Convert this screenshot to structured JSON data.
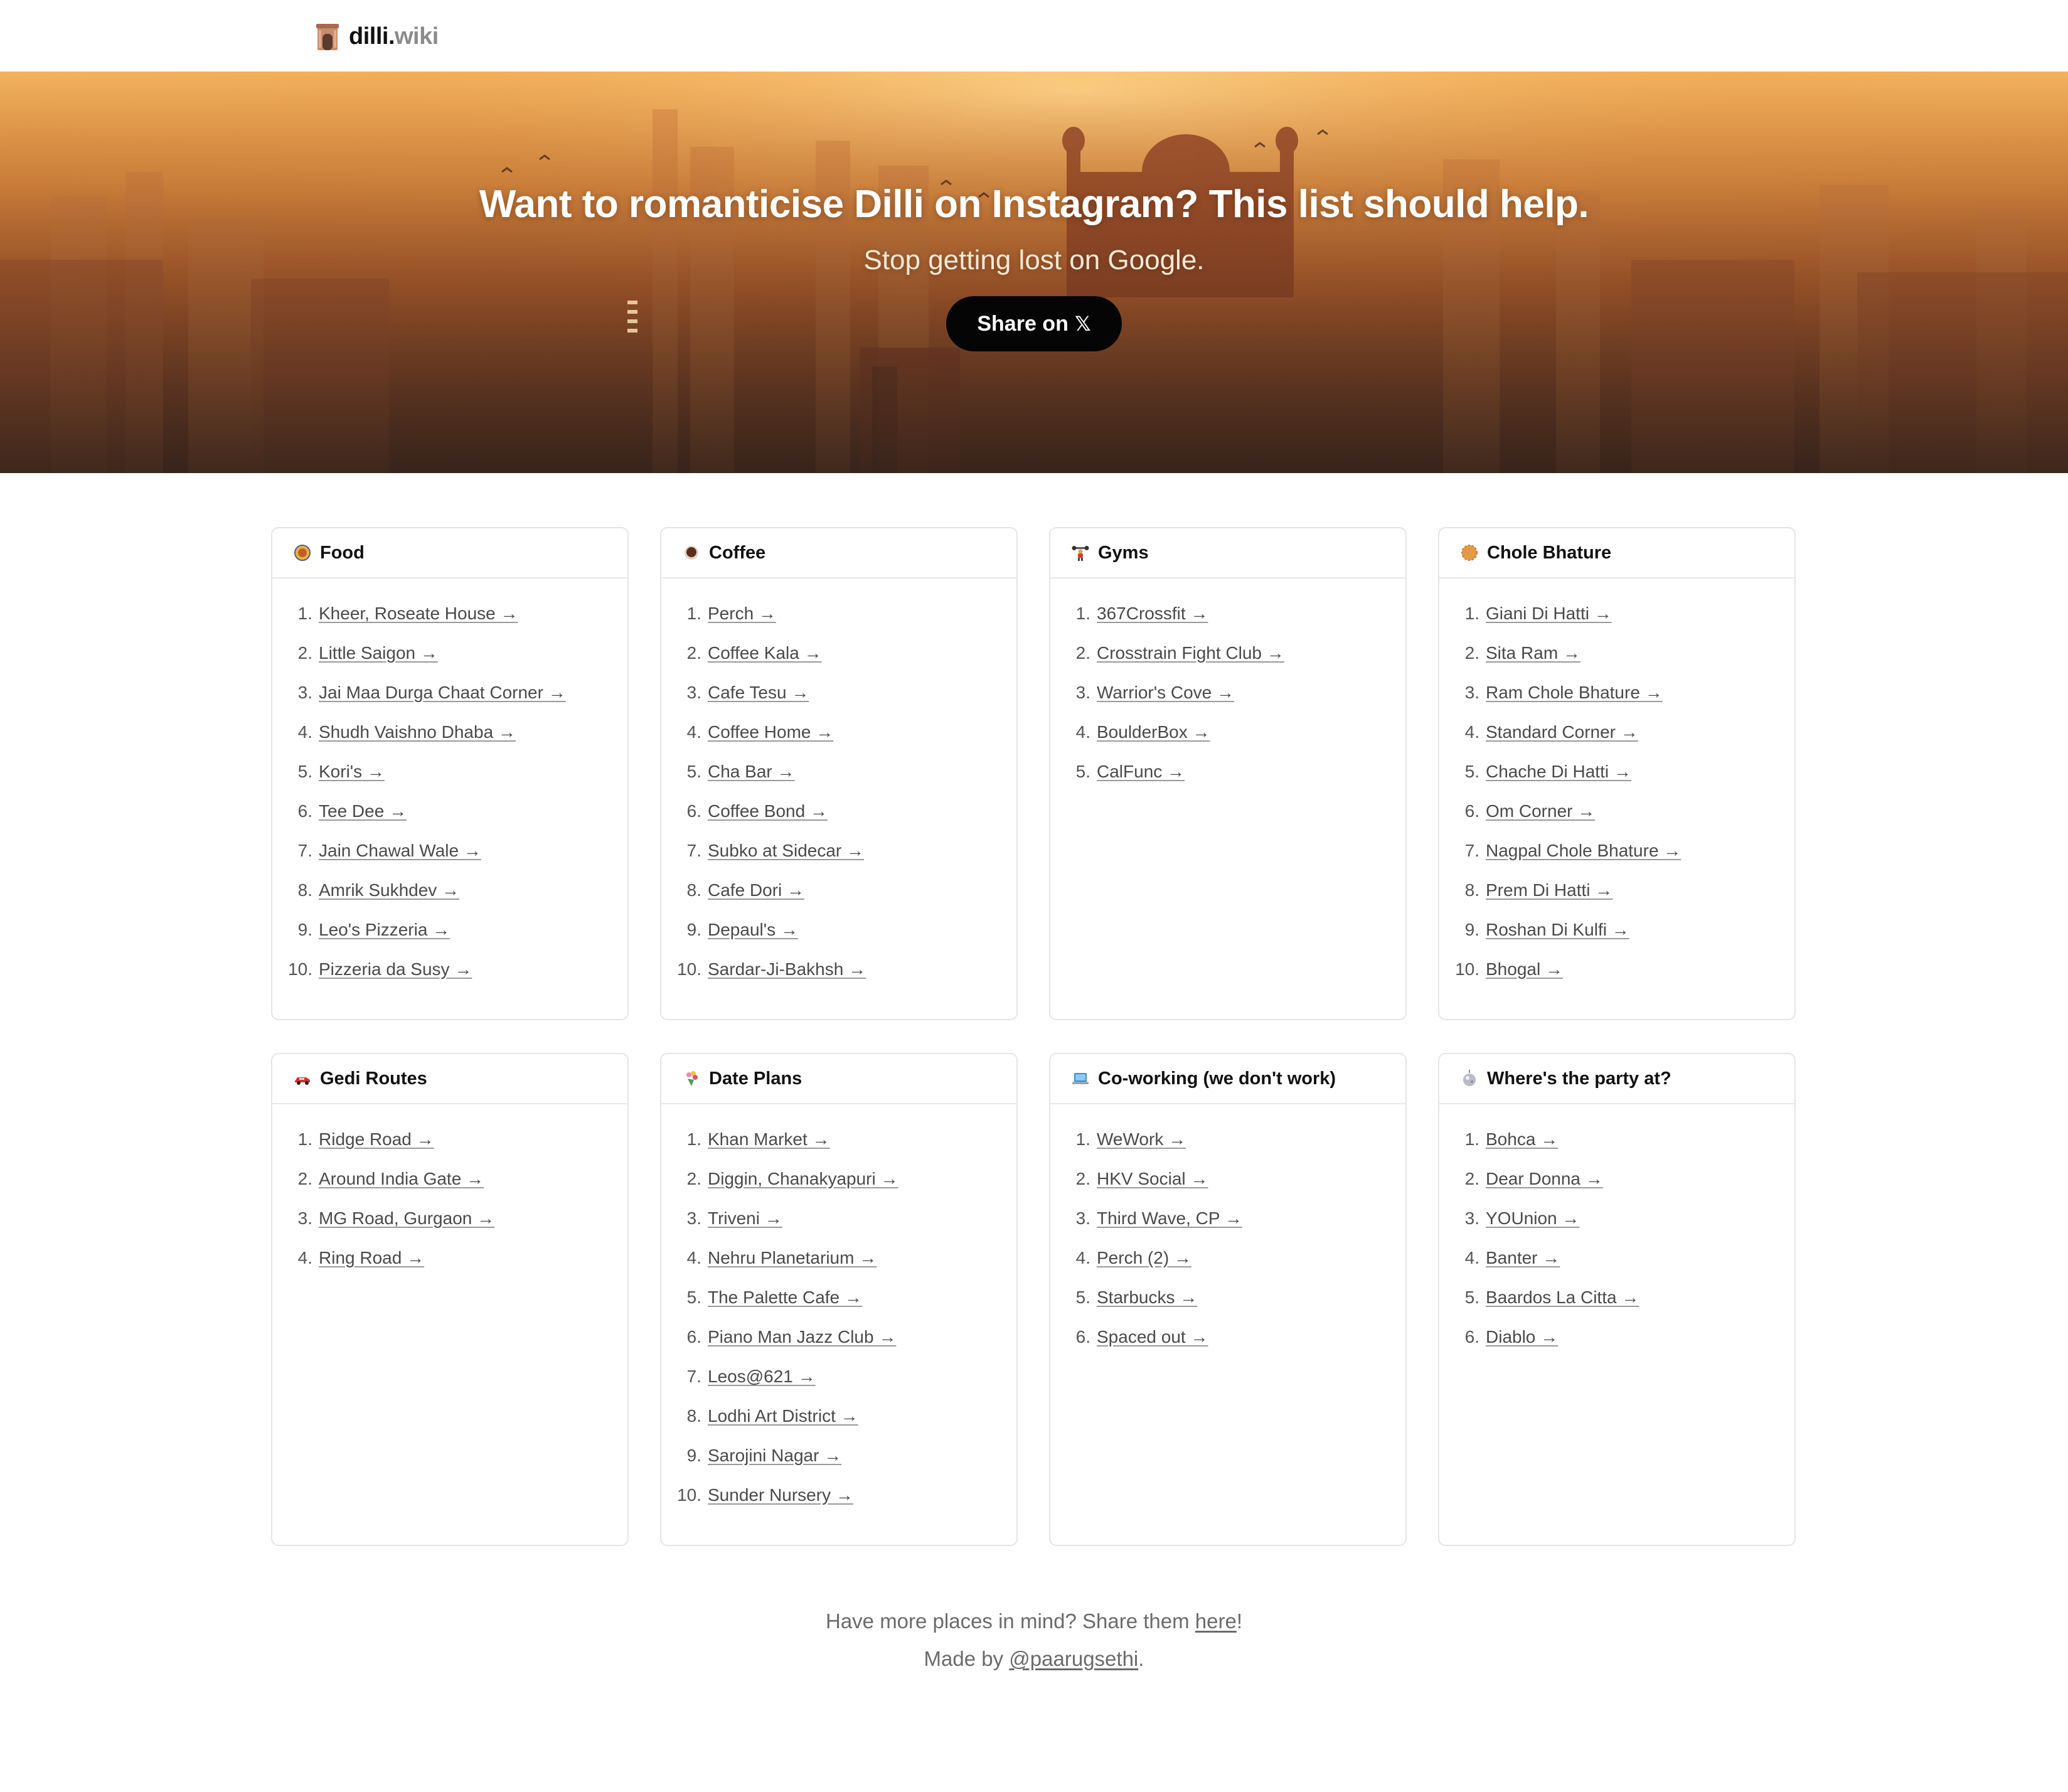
{
  "brand": {
    "name": "dilli.",
    "suffix": "wiki",
    "icon": "india-gate-icon"
  },
  "hero": {
    "title": "Want to romanticise Dilli on Instagram? This list should help.",
    "subtitle": "Stop getting lost on Google.",
    "share_label": "Share on",
    "share_glyph": "𝕏"
  },
  "colors": {
    "accent": "#050505",
    "hero_tint": "#e79642",
    "border": "#e5e5e5"
  },
  "cards": [
    {
      "title": "Food",
      "icon": "curry-bowl-icon",
      "items": [
        "Kheer, Roseate House →",
        "Little Saigon →",
        "Jai Maa Durga Chaat Corner →",
        "Shudh Vaishno Dhaba →",
        "Kori's →",
        "Tee Dee →",
        "Jain Chawal Wale →",
        "Amrik Sukhdev →",
        "Leo's Pizzeria →",
        "Pizzeria da Susy →"
      ]
    },
    {
      "title": "Coffee",
      "icon": "coffee-icon",
      "items": [
        "Perch →",
        "Coffee Kala →",
        "Cafe Tesu →",
        "Coffee Home →",
        "Cha Bar →",
        "Coffee Bond →",
        "Subko at Sidecar →",
        "Cafe Dori →",
        "Depaul's →",
        "Sardar-Ji-Bakhsh →"
      ]
    },
    {
      "title": "Gyms",
      "icon": "weightlifter-icon",
      "items": [
        "367Crossfit →",
        "Crosstrain Fight Club →",
        "Warrior's Cove →",
        "BoulderBox →",
        "CalFunc →"
      ]
    },
    {
      "title": "Chole Bhature",
      "icon": "bhatura-icon",
      "items": [
        "Giani Di Hatti →",
        "Sita Ram →",
        "Ram Chole Bhature →",
        "Standard Corner →",
        "Chache Di Hatti →",
        "Om Corner →",
        "Nagpal Chole Bhature →",
        "Prem Di Hatti →",
        "Roshan Di Kulfi →",
        "Bhogal →"
      ]
    },
    {
      "title": "Gedi Routes",
      "icon": "car-icon",
      "items": [
        "Ridge Road →",
        "Around India Gate →",
        "MG Road, Gurgaon →",
        "Ring Road →"
      ]
    },
    {
      "title": "Date Plans",
      "icon": "bouquet-icon",
      "items": [
        "Khan Market →",
        "Diggin, Chanakyapuri →",
        "Triveni →",
        "Nehru Planetarium →",
        "The Palette Cafe →",
        "Piano Man Jazz Club →",
        "Leos@621 →",
        "Lodhi Art District →",
        "Sarojini Nagar →",
        "Sunder Nursery →"
      ]
    },
    {
      "title": "Co-working (we don't work)",
      "icon": "laptop-icon",
      "items": [
        "WeWork →",
        "HKV Social →",
        "Third Wave, CP →",
        "Perch (2) →",
        "Starbucks →",
        "Spaced out →"
      ]
    },
    {
      "title": "Where's the party at?",
      "icon": "disco-ball-icon",
      "items": [
        "Bohca →",
        "Dear Donna →",
        "YOUnion →",
        "Banter →",
        "Baardos La Citta →",
        "Diablo →"
      ]
    }
  ],
  "footer": {
    "line1_prefix": "Have more places in mind? Share them ",
    "line1_link": "here",
    "line1_suffix": "!",
    "line2_prefix": "Made by ",
    "line2_link": "@paarugsethi",
    "line2_suffix": "."
  }
}
